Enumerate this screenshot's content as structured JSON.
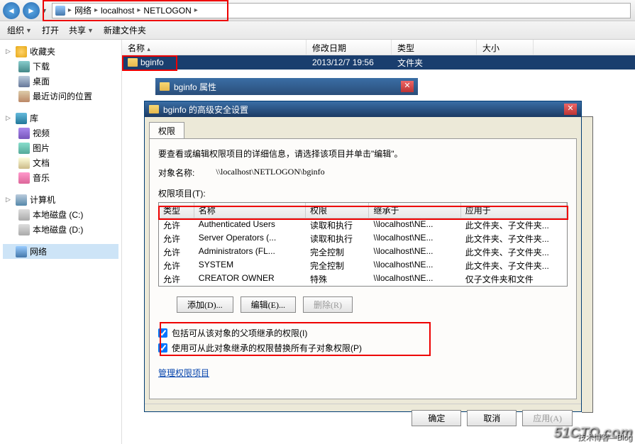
{
  "address": {
    "seg1": "网络",
    "seg2": "localhost",
    "seg3": "NETLOGON"
  },
  "toolbar2": {
    "org": "组织",
    "open": "打开",
    "share": "共享",
    "newfolder": "新建文件夹"
  },
  "nav": {
    "fav": "收藏夹",
    "dl": "下载",
    "desk": "桌面",
    "recent": "最近访问的位置",
    "lib": "库",
    "vid": "视频",
    "pic": "图片",
    "doc": "文档",
    "music": "音乐",
    "pc": "计算机",
    "diskc": "本地磁盘 (C:)",
    "diskd": "本地磁盘 (D:)",
    "net": "网络"
  },
  "cols": {
    "name": "名称",
    "date": "修改日期",
    "type": "类型",
    "size": "大小"
  },
  "filerow": {
    "name": "bginfo",
    "date": "2013/12/7 19:56",
    "type": "文件夹"
  },
  "propdlg": {
    "title": "bginfo 属性"
  },
  "secdlg": {
    "title": "bginfo 的高级安全设置",
    "tab": "权限",
    "intro": "要查看或编辑权限项目的详细信息，请选择该项目并单击\"编辑\"。",
    "objlabel": "对象名称:",
    "objpath": "\\\\localhost\\NETLOGON\\bginfo",
    "permlabel": "权限项目(T):",
    "head": {
      "c1": "类型",
      "c2": "名称",
      "c3": "权限",
      "c4": "继承于",
      "c5": "应用于"
    },
    "rows": [
      {
        "c1": "允许",
        "c2": "Authenticated Users",
        "c3": "读取和执行",
        "c4": "\\\\localhost\\NE...",
        "c5": "此文件夹、子文件夹..."
      },
      {
        "c1": "允许",
        "c2": "Server Operators (...",
        "c3": "读取和执行",
        "c4": "\\\\localhost\\NE...",
        "c5": "此文件夹、子文件夹..."
      },
      {
        "c1": "允许",
        "c2": "Administrators (FL...",
        "c3": "完全控制",
        "c4": "\\\\localhost\\NE...",
        "c5": "此文件夹、子文件夹..."
      },
      {
        "c1": "允许",
        "c2": "SYSTEM",
        "c3": "完全控制",
        "c4": "\\\\localhost\\NE...",
        "c5": "此文件夹、子文件夹..."
      },
      {
        "c1": "允许",
        "c2": "CREATOR OWNER",
        "c3": "特殊",
        "c4": "\\\\localhost\\NE...",
        "c5": "仅子文件夹和文件"
      }
    ],
    "btns": {
      "add": "添加(D)...",
      "edit": "编辑(E)...",
      "del": "删除(R)"
    },
    "chk1": "包括可从该对象的父项继承的权限(I)",
    "chk2": "使用可从此对象继承的权限替换所有子对象权限(P)",
    "link": "管理权限项目",
    "foot": {
      "ok": "确定",
      "cancel": "取消",
      "apply": "应用(A)"
    }
  },
  "watermark": {
    "main": "51CTO.com",
    "sub": "技术博客—Blog"
  }
}
